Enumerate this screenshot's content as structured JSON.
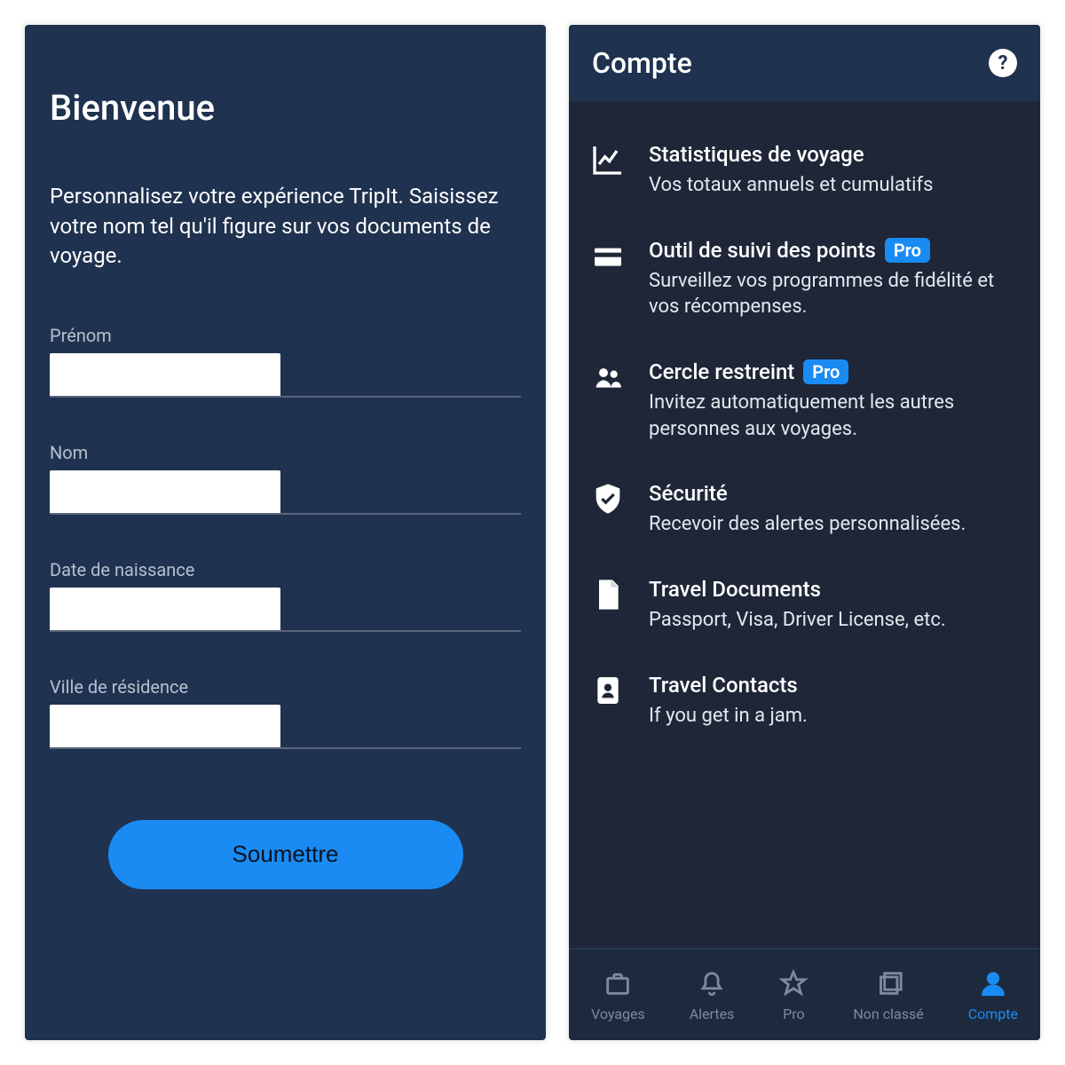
{
  "left": {
    "title": "Bienvenue",
    "subtitle": "Personnalisez votre expérience TripIt. Saisissez votre nom tel qu'il figure sur vos documents de voyage.",
    "fields": {
      "first_name_label": "Prénom",
      "last_name_label": "Nom",
      "dob_label": "Date de naissance",
      "city_label": "Ville de résidence"
    },
    "submit_label": "Soumettre"
  },
  "right": {
    "header_title": "Compte",
    "items": [
      {
        "icon": "chart",
        "title": "Statistiques de voyage",
        "subtitle": "Vos totaux annuels et cumulatifs",
        "pro": false
      },
      {
        "icon": "card",
        "title": "Outil de suivi des points",
        "subtitle": "Surveillez vos programmes de fidélité et vos récompenses.",
        "pro": true
      },
      {
        "icon": "group",
        "title": "Cercle restreint",
        "subtitle": "Invitez automatiquement les autres personnes aux voyages.",
        "pro": true
      },
      {
        "icon": "shield",
        "title": "Sécurité",
        "subtitle": "Recevoir des alertes personnalisées.",
        "pro": false
      },
      {
        "icon": "doc",
        "title": "Travel Documents",
        "subtitle": "Passport, Visa, Driver License, etc.",
        "pro": false
      },
      {
        "icon": "contact",
        "title": "Travel Contacts",
        "subtitle": "If you get in a jam.",
        "pro": false
      }
    ],
    "pro_badge": "Pro",
    "nav": [
      {
        "label": "Voyages",
        "icon": "case",
        "active": false
      },
      {
        "label": "Alertes",
        "icon": "bell",
        "active": false
      },
      {
        "label": "Pro",
        "icon": "star",
        "active": false
      },
      {
        "label": "Non classé",
        "icon": "stack",
        "active": false
      },
      {
        "label": "Compte",
        "icon": "person",
        "active": true
      }
    ]
  }
}
